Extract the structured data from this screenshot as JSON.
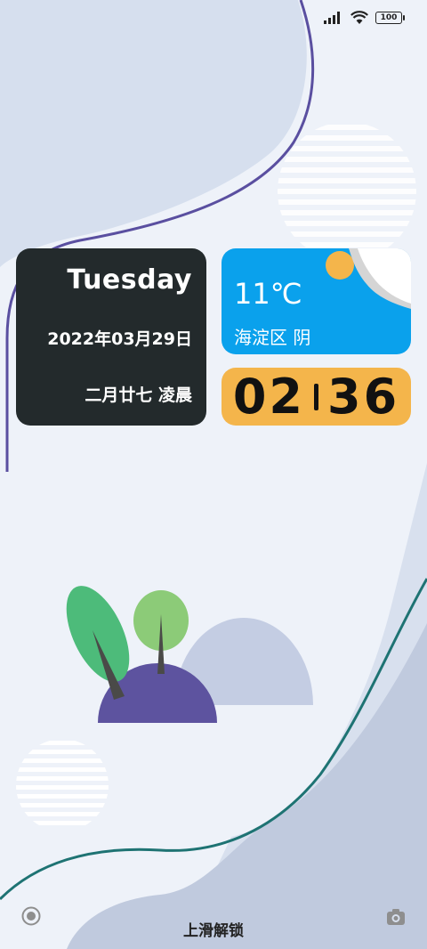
{
  "status": {
    "signal_icon": "signal-icon",
    "wifi_icon": "wifi-icon",
    "battery_level": "100"
  },
  "date_widget": {
    "weekday": "Tuesday",
    "date": "2022年03月29日",
    "lunar": "二月廿七 凌晨"
  },
  "weather_widget": {
    "temperature": "11℃",
    "location_condition": "海淀区  阴",
    "icon": "cloudy-sun-icon"
  },
  "clock_widget": {
    "hours": "02",
    "minutes": "36"
  },
  "lock": {
    "unlock_hint": "上滑解锁",
    "left_icon": "assistant-circle-icon",
    "right_icon": "camera-icon"
  },
  "colors": {
    "date_card_bg": "#232a2c",
    "weather_card_bg": "#0aa1ec",
    "clock_card_bg": "#f4b54b"
  }
}
